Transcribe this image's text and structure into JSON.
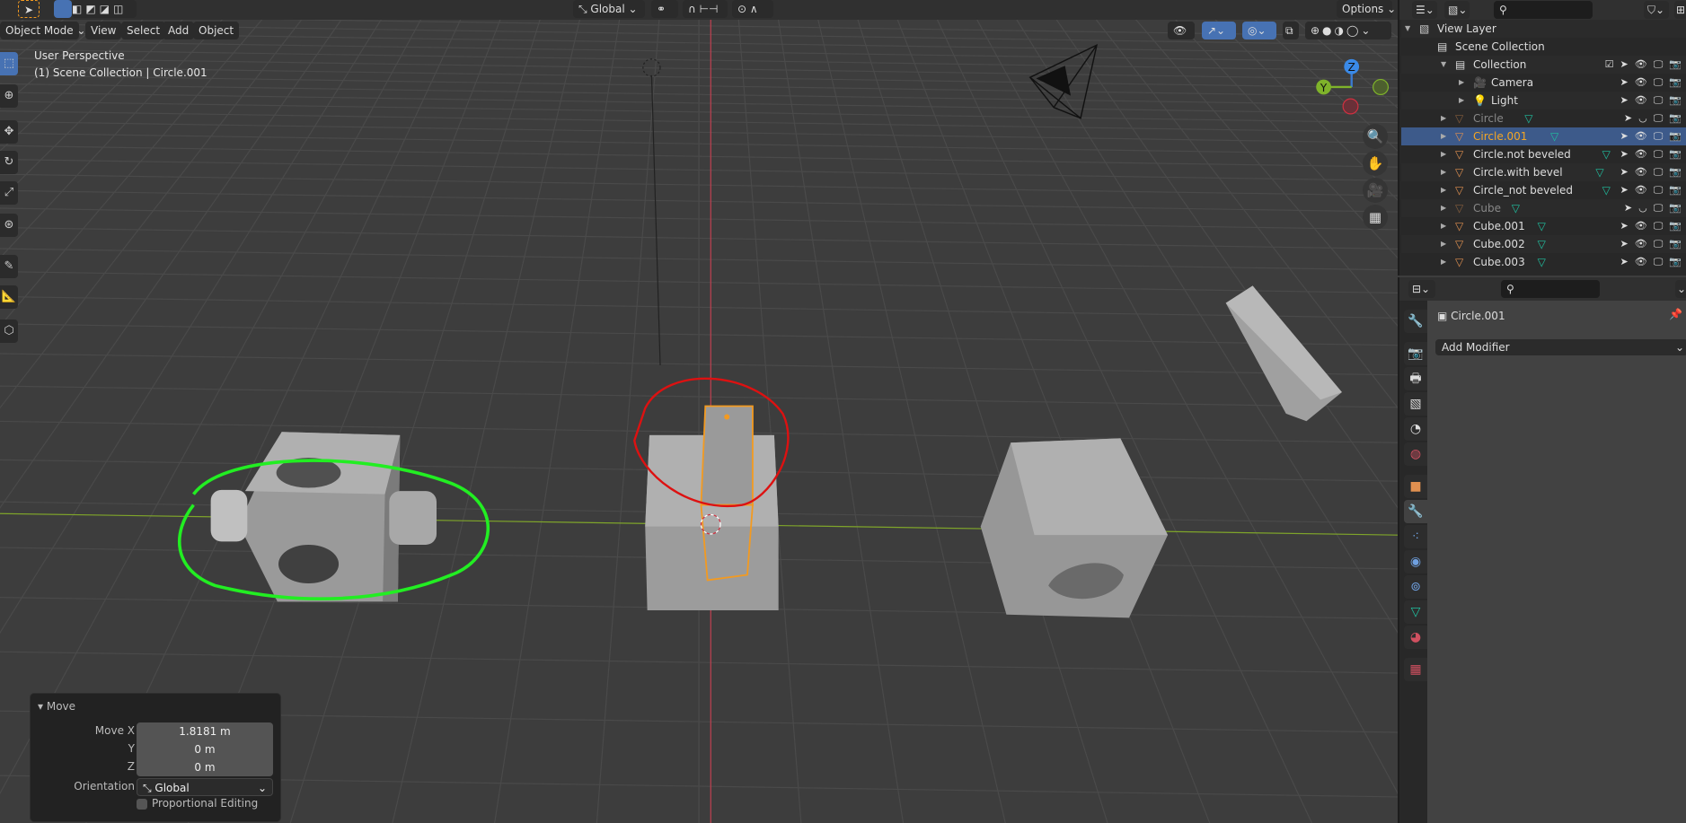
{
  "header": {
    "mode": "Object Mode",
    "menus": [
      "View",
      "Select",
      "Add",
      "Object"
    ],
    "orientation": "Global",
    "options": "Options"
  },
  "viewport": {
    "perspective": "User Perspective",
    "context": "(1) Scene Collection | Circle.001",
    "gizmo": {
      "z": "Z",
      "y": "Y"
    }
  },
  "colors": {
    "accent": "#4772b3",
    "selected_row": "#3d5a8a",
    "active_name": "#f5a623",
    "annotation_green": "#22ee22",
    "annotation_red": "#dd1111",
    "x_axis": "#d03040",
    "y_axis": "#7fb32a"
  },
  "outliner": {
    "rows": [
      {
        "label": "View Layer",
        "icon": "view-layer-icon",
        "indent": 0,
        "expand": "down"
      },
      {
        "label": "Scene Collection",
        "icon": "collection-icon",
        "indent": 1,
        "expand": ""
      },
      {
        "label": "Collection",
        "icon": "collection-icon",
        "indent": 2,
        "expand": "down"
      },
      {
        "label": "Camera",
        "icon": "camera-icon",
        "indent": 3,
        "expand": "right"
      },
      {
        "label": "Light",
        "icon": "light-icon",
        "indent": 3,
        "expand": "right"
      },
      {
        "label": "Circle",
        "icon": "mesh-icon",
        "indent": 2,
        "expand": "right",
        "hidden": true
      },
      {
        "label": "Circle.001",
        "icon": "mesh-icon",
        "indent": 2,
        "expand": "right",
        "selected": true
      },
      {
        "label": "Circle.not beveled",
        "icon": "mesh-icon",
        "indent": 2,
        "expand": "right"
      },
      {
        "label": "Circle.with bevel",
        "icon": "mesh-icon",
        "indent": 2,
        "expand": "right"
      },
      {
        "label": "Circle_not beveled",
        "icon": "mesh-icon",
        "indent": 2,
        "expand": "right"
      },
      {
        "label": "Cube",
        "icon": "mesh-icon",
        "indent": 2,
        "expand": "right",
        "hidden": true
      },
      {
        "label": "Cube.001",
        "icon": "mesh-icon",
        "indent": 2,
        "expand": "right"
      },
      {
        "label": "Cube.002",
        "icon": "mesh-icon",
        "indent": 2,
        "expand": "right"
      },
      {
        "label": "Cube.003",
        "icon": "mesh-icon",
        "indent": 2,
        "expand": "right"
      }
    ]
  },
  "properties": {
    "object_name": "Circle.001",
    "add_modifier": "Add Modifier",
    "tabs": [
      "tool-icon",
      "render-icon",
      "output-icon",
      "view-layer-icon",
      "scene-icon",
      "world-icon",
      "object-icon",
      "modifier-icon",
      "particles-icon",
      "physics-icon",
      "constraints-icon",
      "data-icon",
      "material-icon",
      "texture-icon"
    ],
    "active_tab": "modifier-icon"
  },
  "move_panel": {
    "title": "Move",
    "move_x_label": "Move X",
    "move_x": "1.8181 m",
    "y_label": "Y",
    "y": "0 m",
    "z_label": "Z",
    "z": "0 m",
    "orientation_label": "Orientation",
    "orientation": "Global",
    "proportional": "Proportional Editing",
    "proportional_checked": false
  }
}
